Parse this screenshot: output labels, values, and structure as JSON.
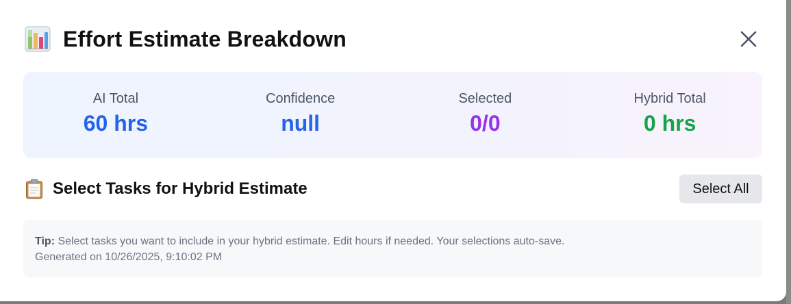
{
  "modal": {
    "title": "Effort Estimate Breakdown",
    "title_icon": "bar-chart-icon",
    "close_icon": "close-icon"
  },
  "stats": [
    {
      "label": "AI Total",
      "value": "60 hrs",
      "color": "#2563eb"
    },
    {
      "label": "Confidence",
      "value": "null",
      "color": "#2563eb"
    },
    {
      "label": "Selected",
      "value": "0/0",
      "color": "#9333ea"
    },
    {
      "label": "Hybrid Total",
      "value": "0 hrs",
      "color": "#16a34a"
    }
  ],
  "section": {
    "icon": "clipboard-icon",
    "title": "Select Tasks for Hybrid Estimate",
    "select_all_label": "Select All"
  },
  "tip": {
    "label": "Tip:",
    "text": " Select tasks you want to include in your hybrid estimate. Edit hours if needed. Your selections auto-save.",
    "generated": "Generated on 10/26/2025, 9:10:02 PM"
  }
}
